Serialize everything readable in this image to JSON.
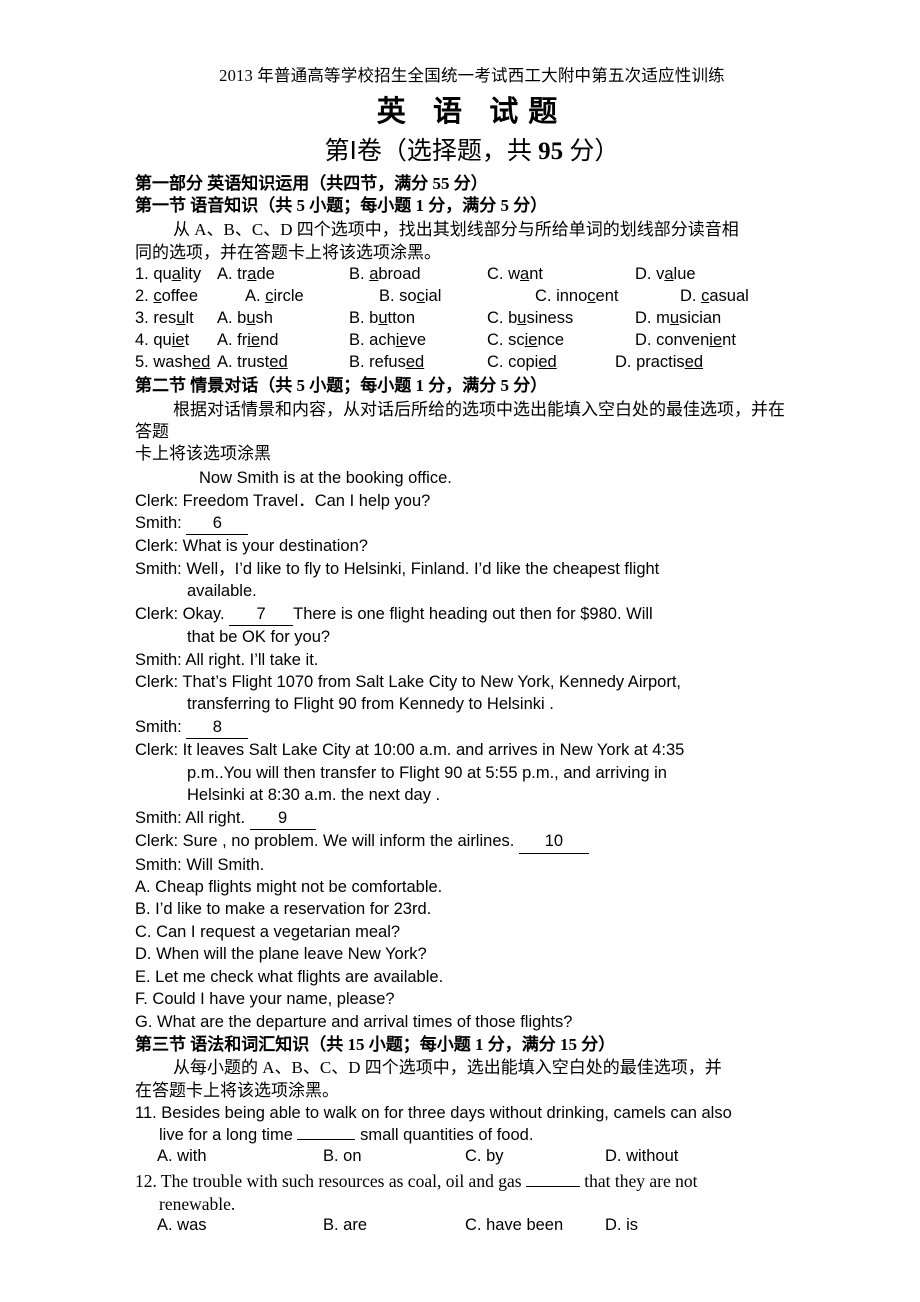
{
  "document": {
    "header_title": "2013 年普通高等学校招生全国统一考试西工大附中第五次适应性训练",
    "subject_title": "英 语  试题",
    "paper_title_prefix": "第Ⅰ卷（选择题，共 ",
    "paper_title_score": "95",
    "paper_title_suffix": " 分）"
  },
  "part_one": {
    "heading": "第一部分 英语知识运用（共四节，满分 55 分）",
    "section_one": {
      "heading": "第一节 语音知识（共 5 小题；每小题 1 分，满分 5 分）",
      "instruction_line1": "从 A、B、C、D 四个选项中，找出其划线部分与所给单词的划线部分读音相",
      "instruction_line2": "同的选项，并在答题卡上将该选项涂黑。",
      "questions": [
        {
          "number": "1.",
          "stem_pre": "qu",
          "stem_u": "a",
          "stem_post": "lity",
          "options": [
            {
              "label": "A. ",
              "pre": "tr",
              "u": "a",
              "post": "de"
            },
            {
              "label": "B. ",
              "pre": "",
              "u": "a",
              "post": "broad"
            },
            {
              "label": "C. ",
              "pre": "w",
              "u": "a",
              "post": "nt"
            },
            {
              "label": "D. ",
              "pre": "v",
              "u": "a",
              "post": "lue"
            }
          ]
        },
        {
          "number": "2.",
          "stem_pre": "",
          "stem_u": "c",
          "stem_post": "offee",
          "options": [
            {
              "label": "A. ",
              "pre": "",
              "u": "c",
              "post": "ircle"
            },
            {
              "label": "B. ",
              "pre": "so",
              "u": "c",
              "post": "ial"
            },
            {
              "label": "C. ",
              "pre": "inno",
              "u": "c",
              "post": "ent"
            },
            {
              "label": "D. ",
              "pre": "",
              "u": "c",
              "post": "asual"
            }
          ]
        },
        {
          "number": "3.",
          "stem_pre": "res",
          "stem_u": "u",
          "stem_post": "lt",
          "options": [
            {
              "label": "A. ",
              "pre": "b",
              "u": "u",
              "post": "sh"
            },
            {
              "label": "B. ",
              "pre": "b",
              "u": "u",
              "post": "tton"
            },
            {
              "label": "C. ",
              "pre": "b",
              "u": "u",
              "post": "siness"
            },
            {
              "label": "D. ",
              "pre": "m",
              "u": "u",
              "post": "sician"
            }
          ]
        },
        {
          "number": "4.",
          "stem_pre": "qu",
          "stem_u": "ie",
          "stem_post": "t",
          "options": [
            {
              "label": "A. ",
              "pre": "fr",
              "u": "ie",
              "post": "nd"
            },
            {
              "label": "B. ",
              "pre": "ach",
              "u": "ie",
              "post": "ve"
            },
            {
              "label": "C. ",
              "pre": "sc",
              "u": "ie",
              "post": "nce"
            },
            {
              "label": "D. ",
              "pre": "conven",
              "u": "ie",
              "post": "nt"
            }
          ]
        },
        {
          "number": "5.",
          "stem_pre": "wash",
          "stem_u": "ed",
          "stem_post": "",
          "options": [
            {
              "label": "A. ",
              "pre": "trust",
              "u": "ed",
              "post": ""
            },
            {
              "label": "B. ",
              "pre": "refus",
              "u": "ed",
              "post": ""
            },
            {
              "label": "C. ",
              "pre": "copi",
              "u": "ed",
              "post": ""
            },
            {
              "label": "D. ",
              "pre": "practis",
              "u": "ed",
              "post": ""
            }
          ]
        }
      ]
    },
    "section_two": {
      "heading": "第二节 情景对话（共 5 小题；每小题 1 分，满分 5 分）",
      "instruction_line1": "根据对话情景和内容，从对话后所给的选项中选出能填入空白处的最佳选项，并在答题",
      "instruction_line2": "卡上将该选项涂黑",
      "scene": "Now Smith is at the booking office.",
      "dialogue": [
        {
          "type": "plain",
          "text": "Clerk: Freedom Travel．Can I help you?"
        },
        {
          "type": "blank_end",
          "pre": "Smith: ",
          "blank": "6",
          "post": ""
        },
        {
          "type": "plain",
          "text": "Clerk: What is your destination?"
        },
        {
          "type": "plain",
          "text": "Smith: Well，I’d like to fly to Helsinki, Finland. I’d like the cheapest flight"
        },
        {
          "type": "cont",
          "text": "available."
        },
        {
          "type": "blank_mid",
          "pre": "Clerk: Okay. ",
          "blank": "7",
          "post": "There is one flight heading out then for $980. Will"
        },
        {
          "type": "cont",
          "text": "that be OK for you?"
        },
        {
          "type": "plain",
          "text": "Smith: All right. I’ll take it."
        },
        {
          "type": "plain",
          "text": "Clerk: That’s Flight 1070 from Salt Lake City to New York, Kennedy Airport,"
        },
        {
          "type": "cont",
          "text": "transferring to Flight 90 from Kennedy to Helsinki ."
        },
        {
          "type": "blank_end",
          "pre": "Smith: ",
          "blank": "8",
          "post": ""
        },
        {
          "type": "plain",
          "text": "Clerk: It leaves Salt Lake City at 10:00 a.m. and arrives in New York at 4:35"
        },
        {
          "type": "cont",
          "text": "p.m..You will then transfer to Flight 90 at 5:55 p.m., and arriving in"
        },
        {
          "type": "cont",
          "text": "Helsinki at 8:30 a.m. the next day ."
        },
        {
          "type": "blank_end",
          "pre": "Smith: All right. ",
          "blank": "9",
          "post": ""
        },
        {
          "type": "blank_end",
          "pre": "Clerk: Sure , no problem. We will inform the airlines. ",
          "blank": "10",
          "post": ""
        },
        {
          "type": "plain",
          "text": "Smith: Will Smith."
        }
      ],
      "options": [
        "A. Cheap flights might not be comfortable.",
        "B. I’d like to make a reservation for 23rd.",
        "C. Can I request a vegetarian meal?",
        "D. When will the plane leave New York?",
        "E. Let me check what flights are available.",
        "F. Could I have your name, please?",
        "G. What are the departure and arrival times of those flights?"
      ]
    },
    "section_three": {
      "heading": "第三节 语法和词汇知识（共 15 小题；每小题 1 分，满分 15 分）",
      "instruction_line1": "从每小题的 A、B、C、D 四个选项中，选出能填入空白处的最佳选项，并",
      "instruction_line2": "在答题卡上将该选项涂黑。",
      "questions": [
        {
          "number": "11.",
          "stem_line1": "Besides being able to walk on for three days without drinking, camels can also",
          "stem_line2_pre": "live for a long time ",
          "stem_line2_post": " small quantities of food.",
          "font": "sans",
          "choices": [
            "A. with",
            "B. on",
            "C. by",
            "D. without"
          ]
        },
        {
          "number": "12.",
          "stem_line1_pre": "The trouble with such resources as coal, oil and gas ",
          "stem_line1_post": " that they are not",
          "stem_line2": "renewable.",
          "font": "serif",
          "choices": [
            "A. was",
            "B. are",
            "C. have been",
            "D. is"
          ]
        }
      ]
    }
  }
}
